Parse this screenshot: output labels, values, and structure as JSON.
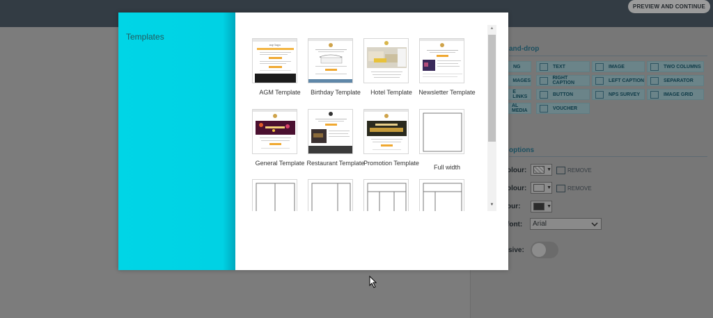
{
  "topbar": {
    "preview_button": "PREVIEW AND CONTINUE"
  },
  "right_panel": {
    "drag_drop_heading": "and-drop",
    "widgets": [
      {
        "label": "NG",
        "icon": "text-icon"
      },
      {
        "label": "TEXT",
        "icon": "text-icon"
      },
      {
        "label": "IMAGE",
        "icon": "image-icon"
      },
      {
        "label": "TWO COLUMNS",
        "icon": "columns-icon"
      },
      {
        "label": "MAGES",
        "icon": "images-icon"
      },
      {
        "label": "RIGHT CAPTION",
        "icon": "right-caption-icon"
      },
      {
        "label": "LEFT CAPTION",
        "icon": "left-caption-icon"
      },
      {
        "label": "SEPARATOR",
        "icon": "separator-icon"
      },
      {
        "label": "E LINKS",
        "icon": "links-icon"
      },
      {
        "label": "BUTTON",
        "icon": "button-icon"
      },
      {
        "label": "NPS SURVEY",
        "icon": "survey-icon"
      },
      {
        "label": "IMAGE GRID",
        "icon": "grid-icon"
      },
      {
        "label": "AL MEDIA",
        "icon": "social-icon"
      },
      {
        "label": "VOUCHER",
        "icon": "voucher-icon"
      }
    ],
    "options_heading": "options",
    "options": {
      "bg_colour_label": "olour:",
      "content_colour_label": "olour:",
      "text_colour_label": "our:",
      "font_label": "font:",
      "font_value": "Arial",
      "responsive_label": "sive:",
      "remove_label": "REMOVE"
    }
  },
  "modal": {
    "title": "Templates",
    "templates": [
      {
        "name": "AGM Template"
      },
      {
        "name": "Birthday Template"
      },
      {
        "name": "Hotel Template"
      },
      {
        "name": "Newsletter Template"
      },
      {
        "name": "General Template"
      },
      {
        "name": "Restaurant Template"
      },
      {
        "name": "Promotion Template"
      },
      {
        "name": "Full width"
      }
    ]
  }
}
